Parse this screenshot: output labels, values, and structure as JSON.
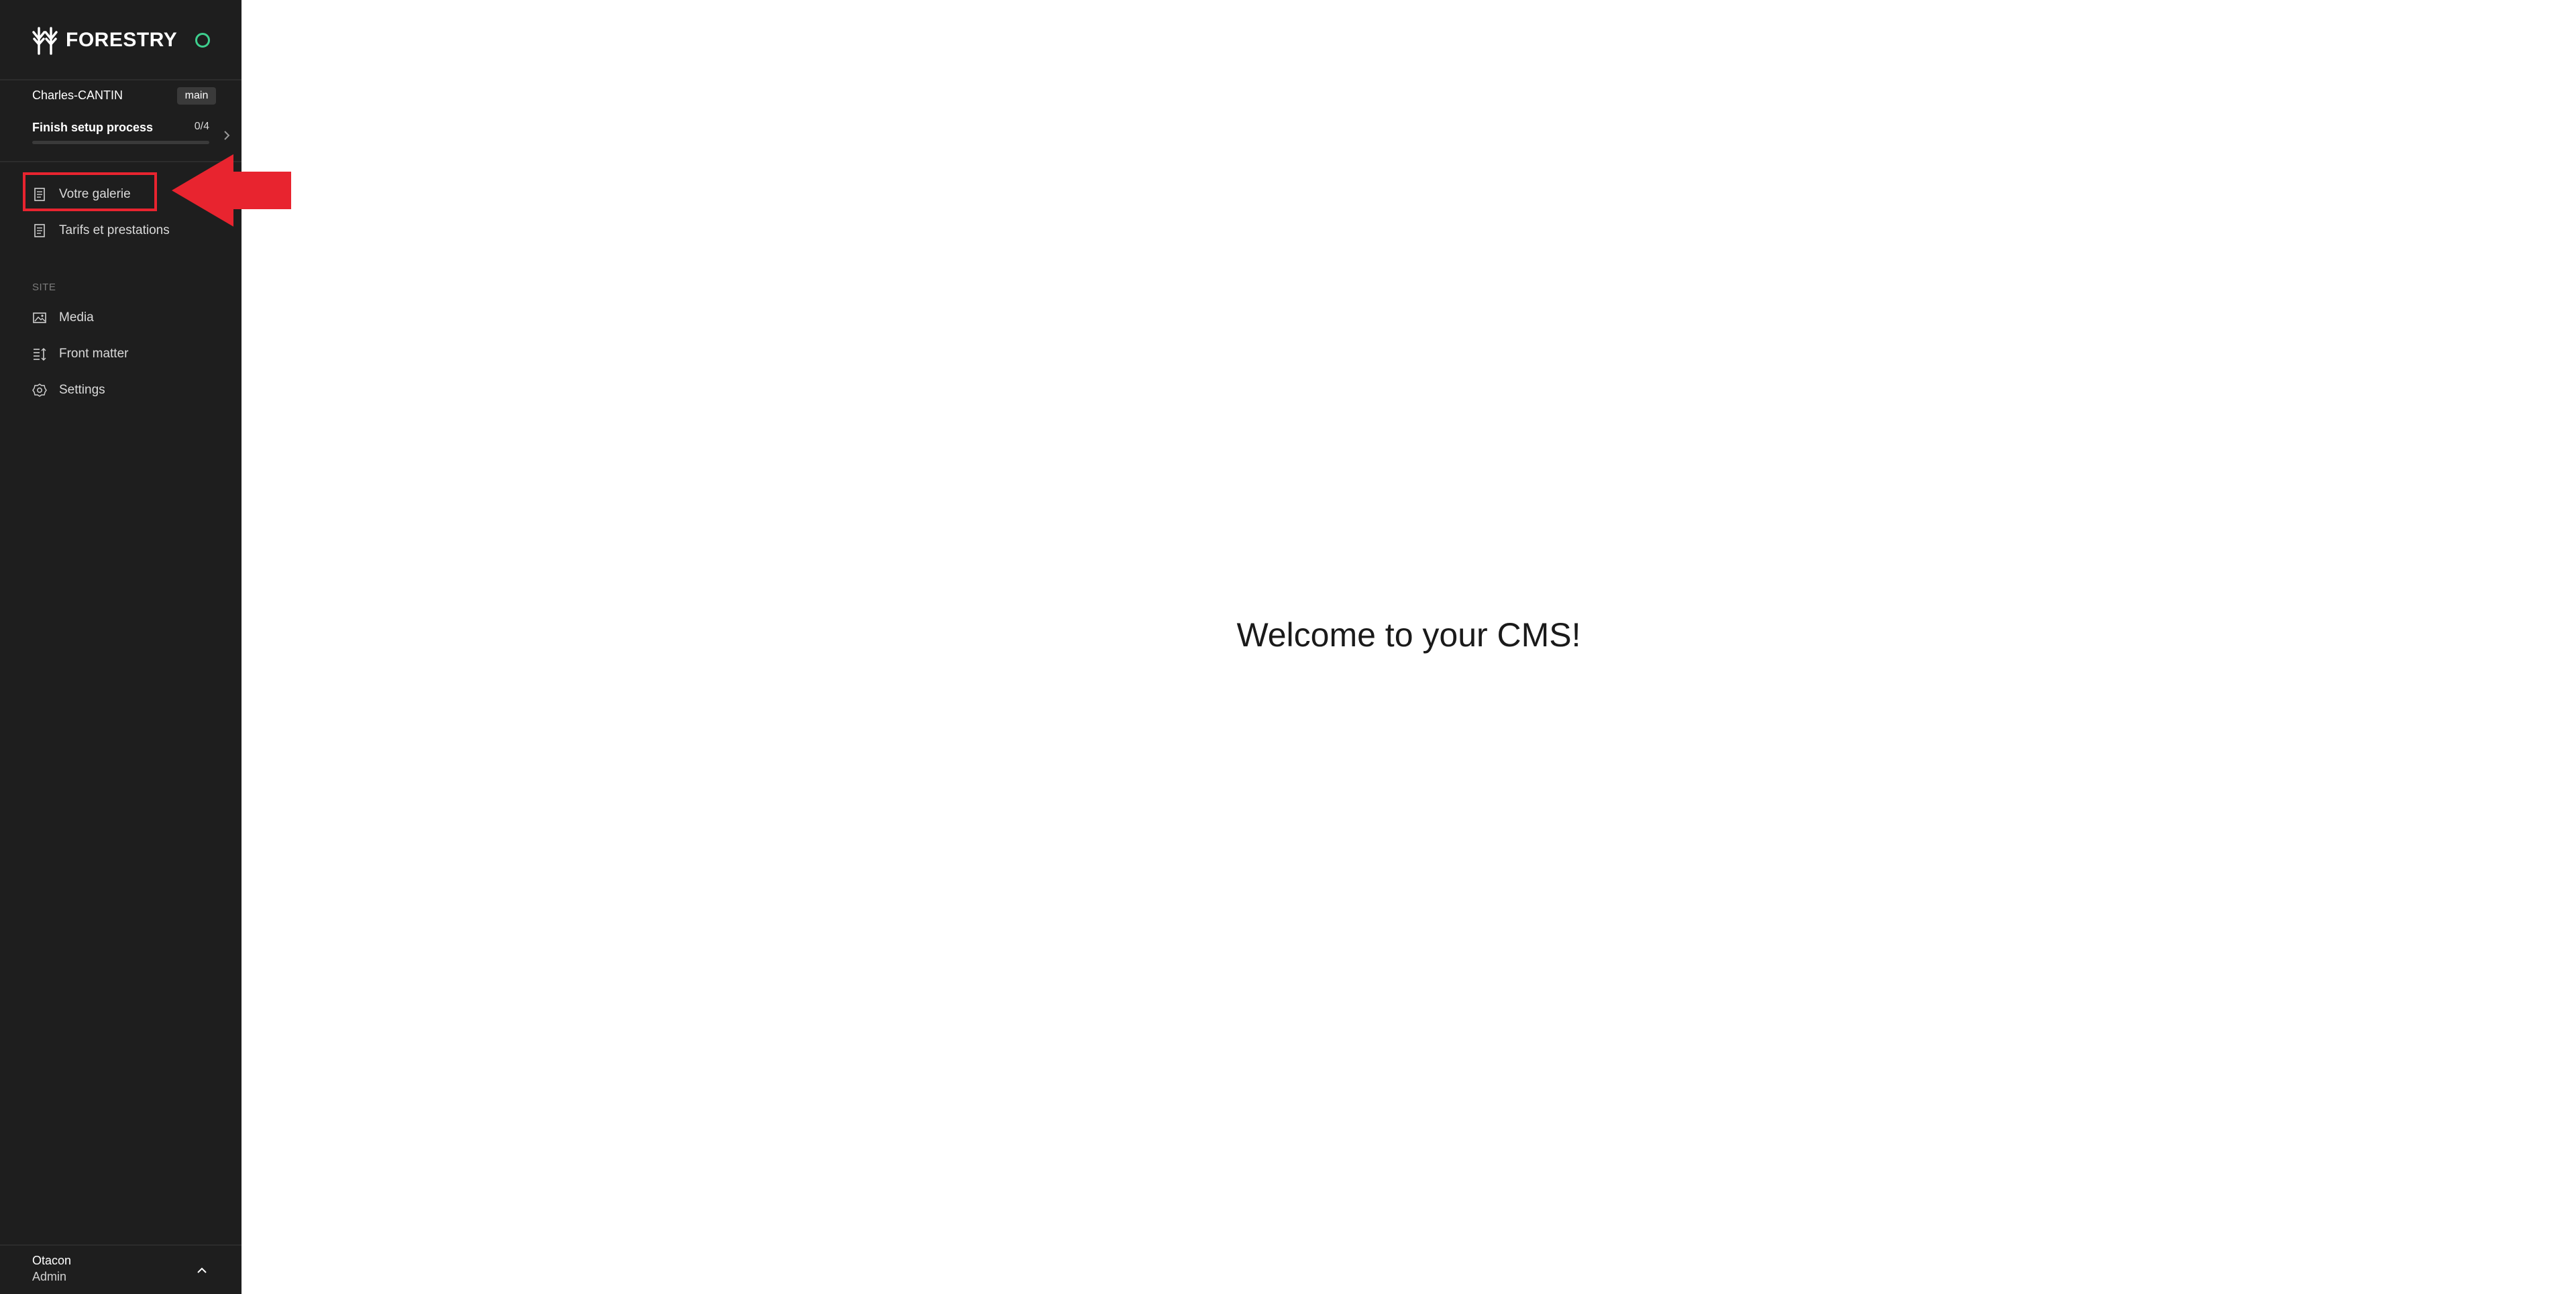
{
  "app": {
    "brand": "FORESTRY",
    "status_color": "#3ecf8e"
  },
  "repo": {
    "name": "Charles-CANTIN",
    "branch": "main"
  },
  "setup": {
    "label": "Finish setup process",
    "count": "0/4",
    "progress_fraction": 0
  },
  "sidebar": {
    "items": [
      {
        "label": "Votre galerie",
        "icon": "document-icon"
      },
      {
        "label": "Tarifs et prestations",
        "icon": "document-icon"
      }
    ],
    "site_section_label": "SITE",
    "site_items": [
      {
        "label": "Media",
        "icon": "image-icon"
      },
      {
        "label": "Front matter",
        "icon": "front-matter-icon"
      },
      {
        "label": "Settings",
        "icon": "gear-icon"
      }
    ]
  },
  "user": {
    "name": "Otacon",
    "role": "Admin"
  },
  "main": {
    "welcome": "Welcome to your CMS!"
  },
  "annotation": {
    "color": "#e8242f"
  }
}
